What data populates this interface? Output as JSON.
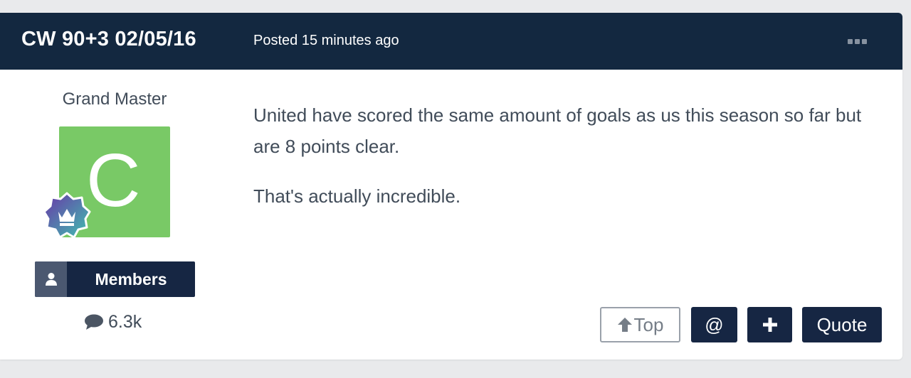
{
  "post": {
    "author": "CW 90+3 02/05/16",
    "posted": "Posted 15 minutes ago",
    "more_icon": "ellipsis-icon",
    "rank": "Grand Master",
    "avatar_letter": "C",
    "avatar_color": "#79c966",
    "badge_icon": "crown-icon",
    "group": "Members",
    "group_icon": "user-icon",
    "content_count": "6.3k",
    "content_count_icon": "comment-icon",
    "body": [
      "United have scored the same amount of goals as us this season so far but are 8 points clear.",
      "That's actually incredible."
    ]
  },
  "actions": {
    "top_label": "Top",
    "mention_label": "@",
    "plus_label": "+",
    "quote_label": "Quote"
  },
  "colors": {
    "header_bg": "#132840",
    "button_dark": "#162643",
    "text": "#414c59",
    "page_bg": "#e9eaec"
  }
}
